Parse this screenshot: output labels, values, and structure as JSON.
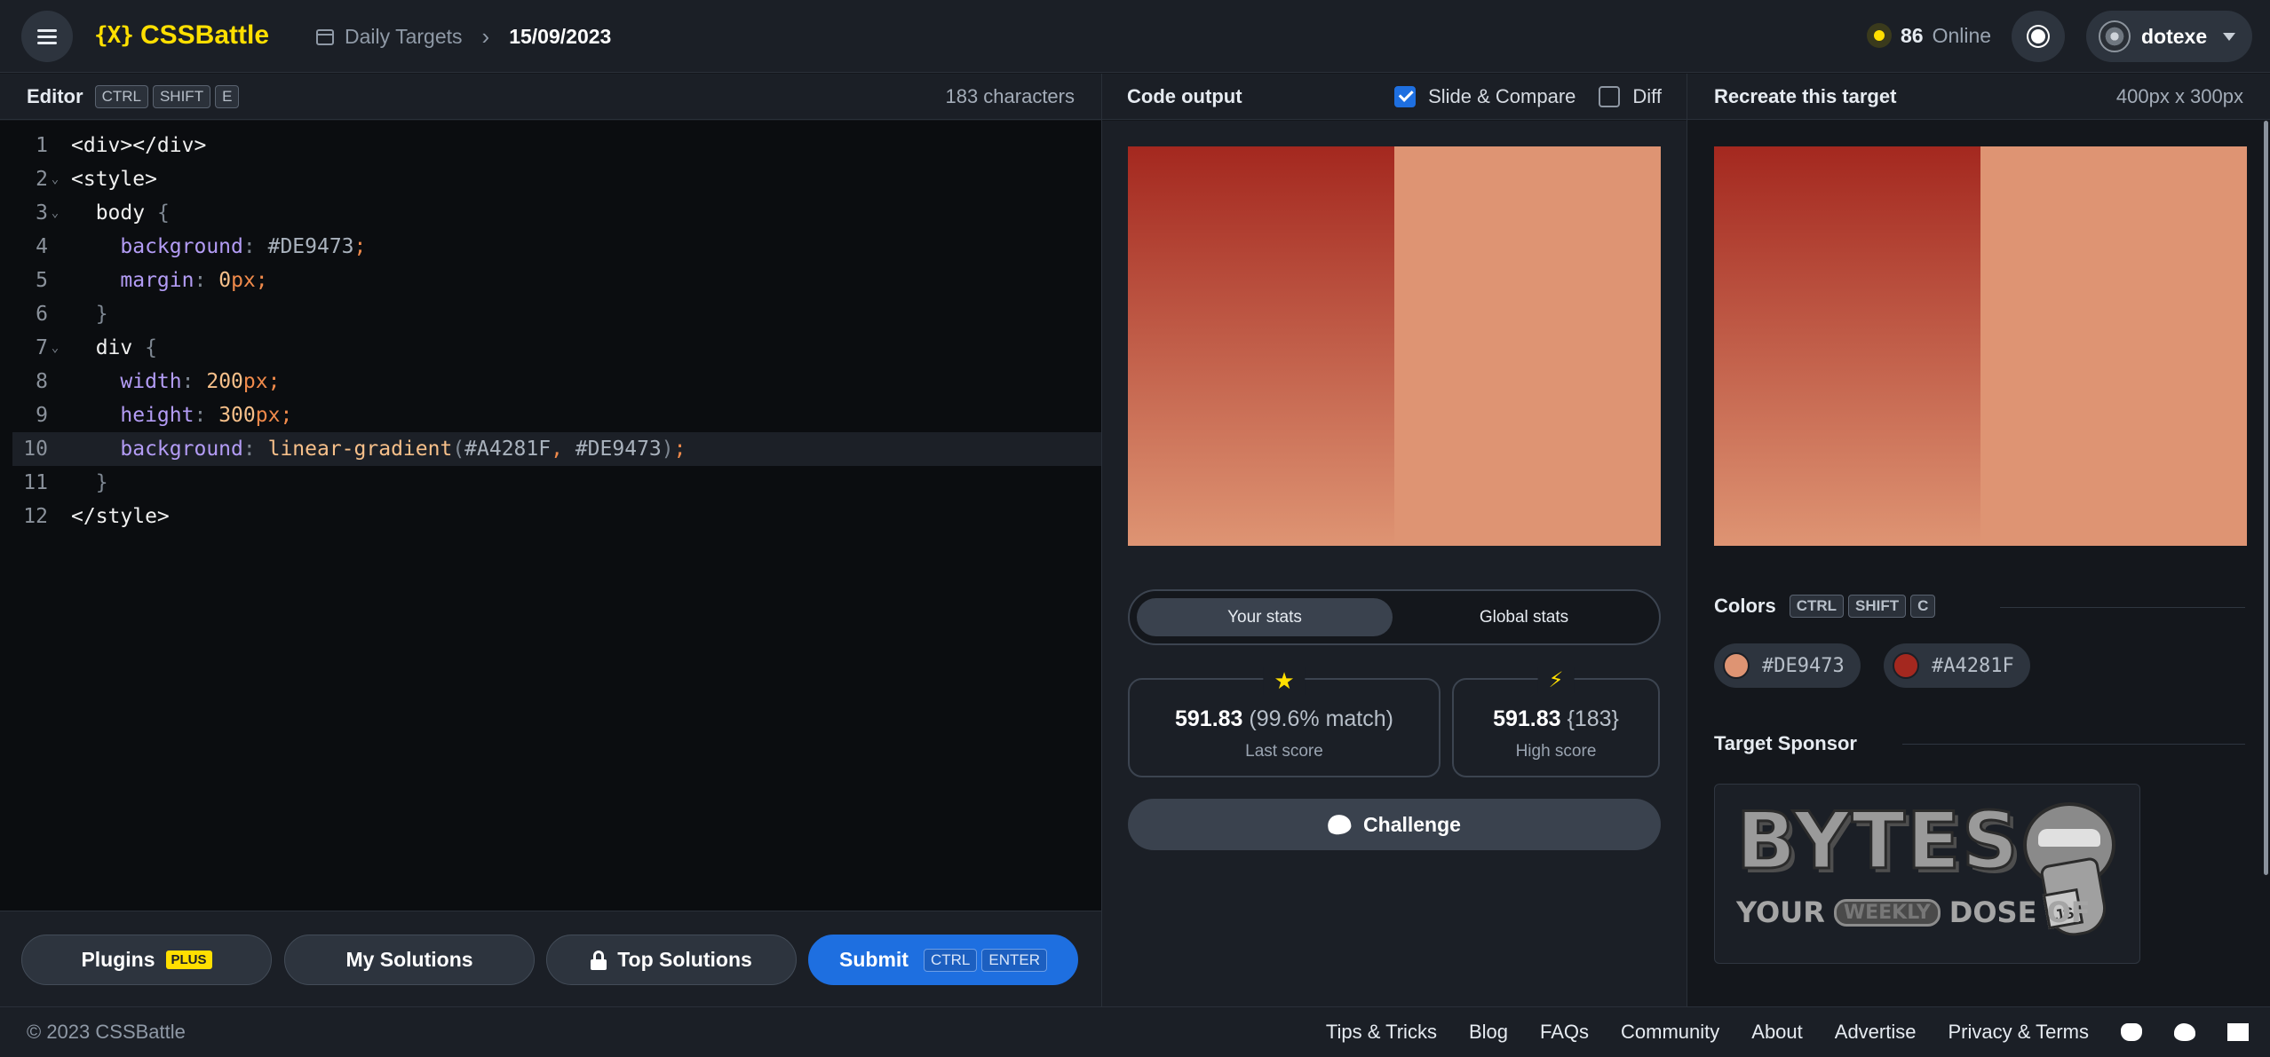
{
  "header": {
    "logo_mark": "{X}",
    "logo_text": "CSSBattle",
    "breadcrumb_section": "Daily Targets",
    "breadcrumb_current": "15/09/2023",
    "online_count": "86",
    "online_label": "Online",
    "username": "dotexe"
  },
  "editor": {
    "title": "Editor",
    "shortcut": [
      "CTRL",
      "SHIFT",
      "E"
    ],
    "char_count": "183 characters",
    "line_numbers": [
      "1",
      "2",
      "3",
      "4",
      "5",
      "6",
      "7",
      "8",
      "9",
      "10",
      "11",
      "12"
    ],
    "active_line": 10
  },
  "code": {
    "l1_open": "<div></div>",
    "l2": "<style>",
    "l3_sel": "body",
    "l4_prop": "background",
    "l4_val": "#DE9473",
    "l5_prop": "margin",
    "l5_num": "0",
    "l5_unit": "px",
    "l7_sel": "div",
    "l8_prop": "width",
    "l8_num": "200",
    "l8_unit": "px",
    "l9_prop": "height",
    "l9_num": "300",
    "l9_unit": "px",
    "l10_prop": "background",
    "l10_fn": "linear-gradient",
    "l10_arg1": "#A4281F",
    "l10_arg2": "#DE9473",
    "l12": "</style>"
  },
  "editor_footer": {
    "plugins_label": "Plugins",
    "plugins_badge": "PLUS",
    "my_solutions_label": "My Solutions",
    "top_solutions_label": "Top Solutions",
    "submit_label": "Submit",
    "submit_shortcut": [
      "CTRL",
      "ENTER"
    ]
  },
  "output": {
    "title": "Code output",
    "slide_compare_label": "Slide & Compare",
    "slide_compare_checked": true,
    "diff_label": "Diff",
    "diff_checked": false,
    "tabs": [
      "Your stats",
      "Global stats"
    ],
    "active_tab": "Your stats",
    "last_score_value": "591.83",
    "last_score_match": "(99.6% match)",
    "last_score_label": "Last score",
    "high_score_value": "591.83",
    "high_score_chars": "{183}",
    "high_score_label": "High score",
    "challenge_label": "Challenge"
  },
  "target": {
    "title": "Recreate this target",
    "size": "400px x 300px",
    "colors_title": "Colors",
    "colors_shortcut": [
      "CTRL",
      "SHIFT",
      "C"
    ],
    "colors": [
      "#DE9473",
      "#A4281F"
    ],
    "sponsor_title": "Target Sponsor",
    "sponsor_big": "BYTES",
    "sponsor_small_1": "YOUR",
    "sponsor_small_weekly": "WEEKLY",
    "sponsor_small_2": "DOSE OF",
    "sponsor_js": "JS"
  },
  "palette": {
    "accent": "#ffdf00",
    "primary_blue": "#1e6fe0",
    "dark_red": "#A4281F",
    "salmon": "#DE9473"
  },
  "footer": {
    "copyright": "© 2023 CSSBattle",
    "links": [
      "Tips & Tricks",
      "Blog",
      "FAQs",
      "Community",
      "About",
      "Advertise",
      "Privacy & Terms"
    ]
  }
}
